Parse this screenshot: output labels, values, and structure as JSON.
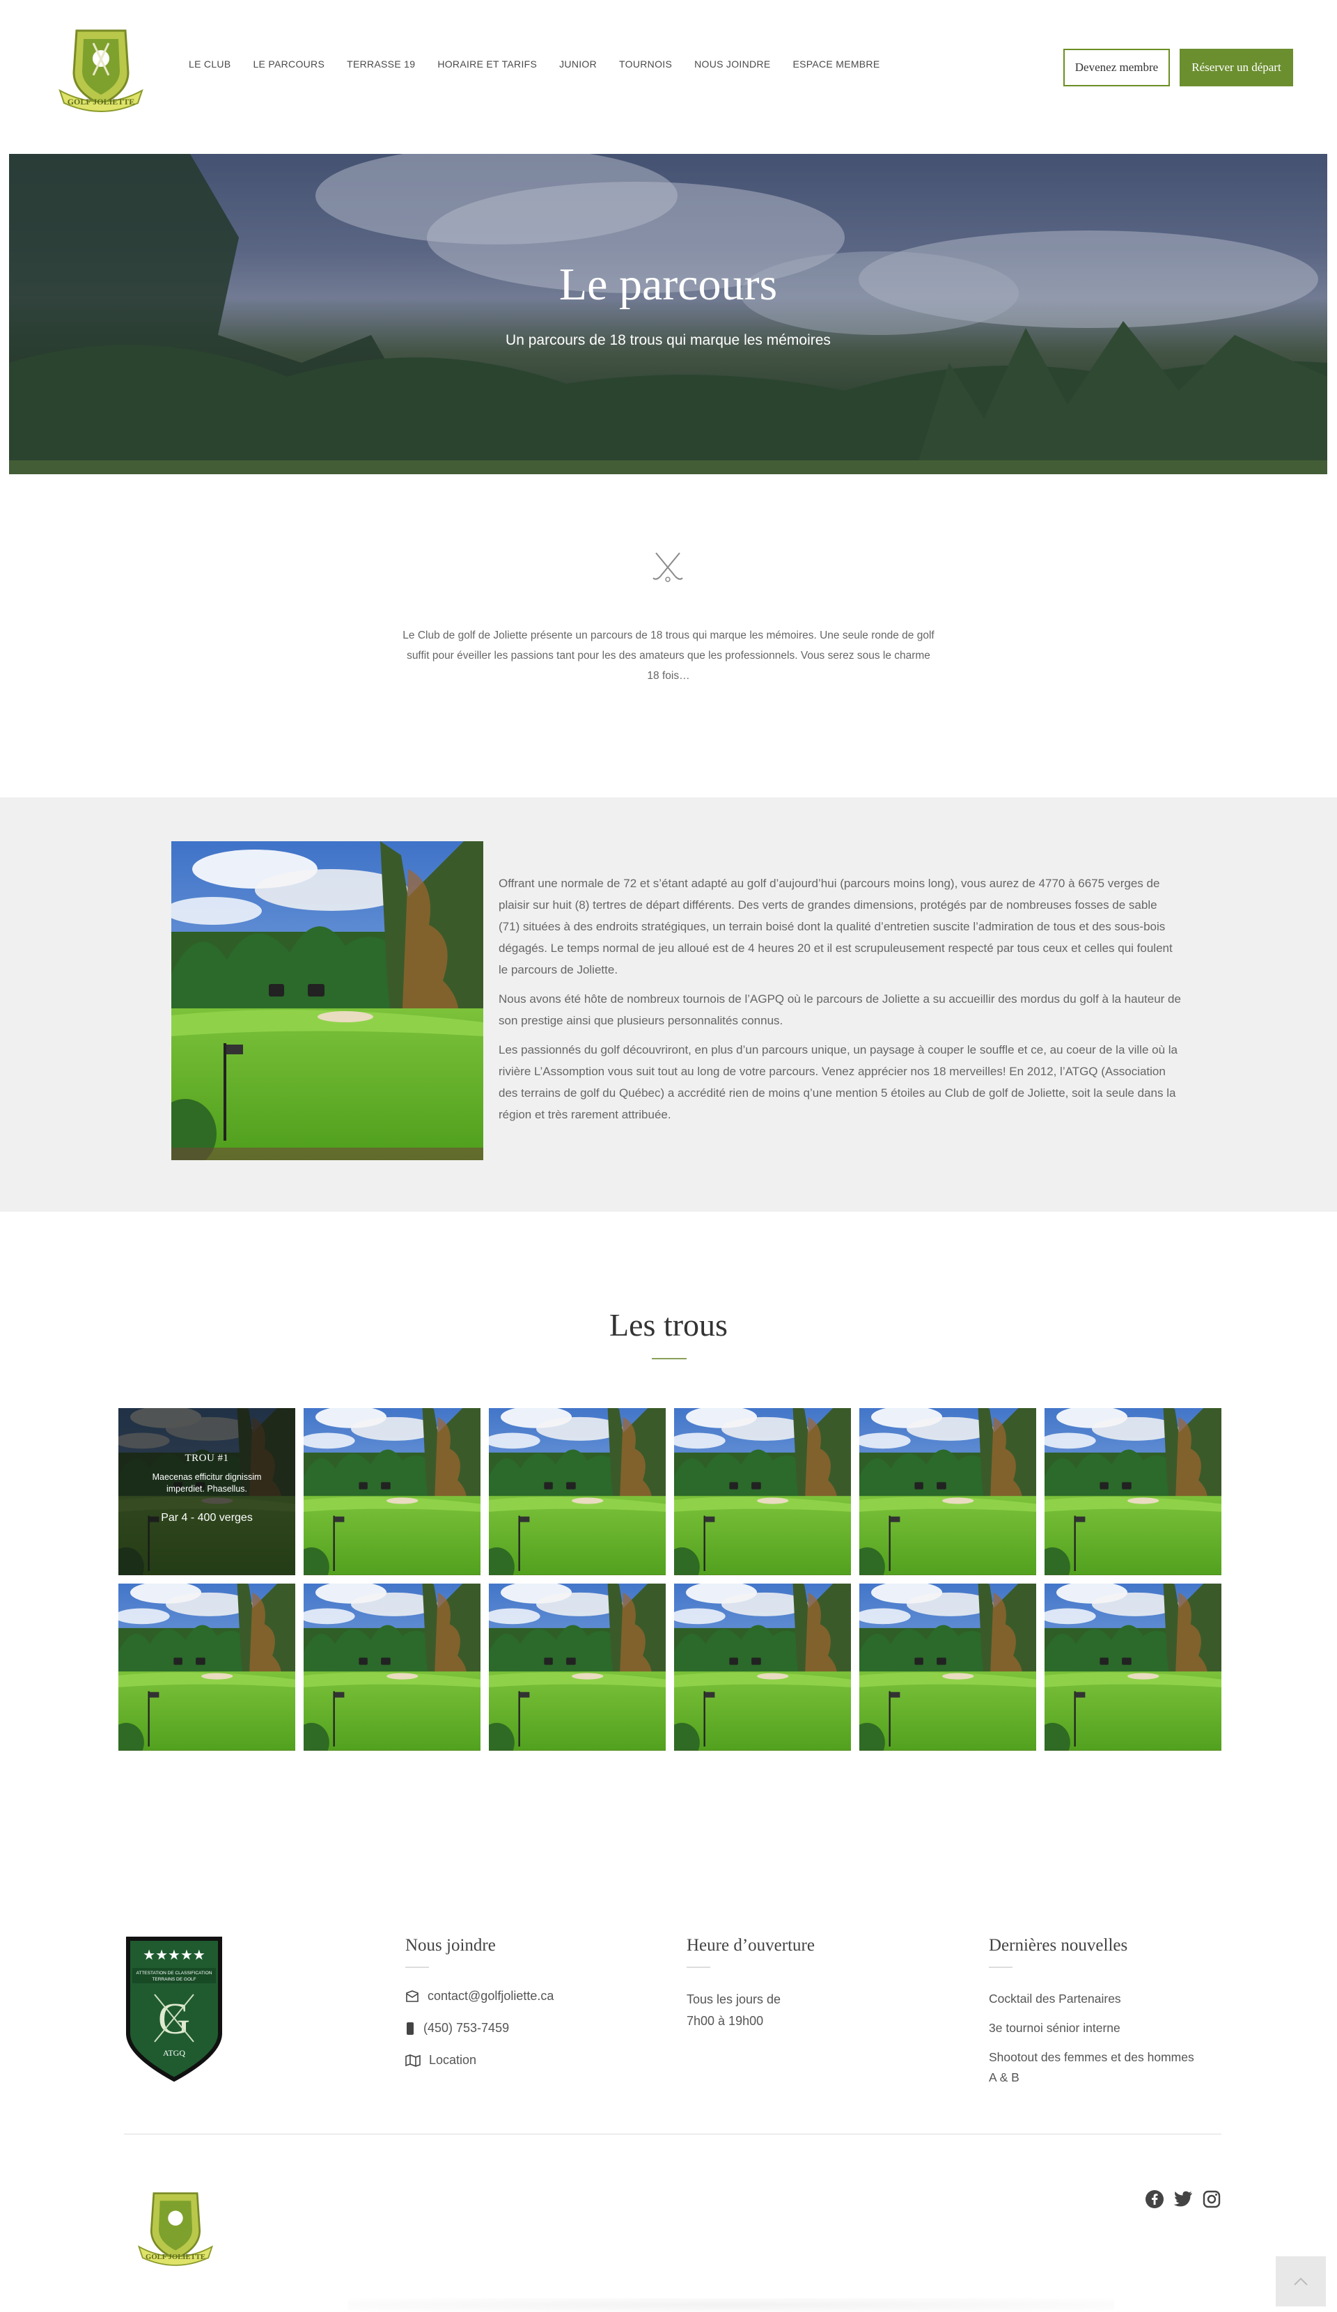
{
  "header": {
    "logo_alt": "Golf Joliette",
    "nav": [
      "LE CLUB",
      "LE PARCOURS",
      "TERRASSE 19",
      "HORAIRE ET TARIFS",
      "JUNIOR",
      "TOURNOIS",
      "NOUS JOINDRE",
      "ESPACE MEMBRE"
    ],
    "btn_member": "Devenez membre",
    "btn_book": "Réserver un départ"
  },
  "hero": {
    "title": "Le parcours",
    "subtitle": "Un parcours de 18 trous qui marque les mémoires"
  },
  "intro": {
    "icon": "crossed-golf-clubs-icon",
    "text": "Le Club de golf de Joliette présente un parcours de 18 trous qui marque les mémoires. Une seule ronde de golf suffit pour éveiller les passions tant pour les des amateurs que les professionnels. Vous serez sous le charme 18 fois…"
  },
  "description": {
    "p1": "Offrant une normale de 72 et s’étant adapté au golf d’aujourd’hui (parcours moins long), vous aurez de 4770 à 6675 verges de plaisir sur huit (8) tertres de départ différents. Des verts de grandes dimensions, protégés par de nombreuses fosses de sable (71) situées à des endroits stratégiques, un terrain boisé dont la qualité d’entretien suscite l’admiration de tous et des sous-bois dégagés. Le temps normal de jeu alloué est de 4 heures 20 et il est scrupuleusement respecté par tous ceux et celles qui foulent le parcours de Joliette.",
    "p2": "Nous avons été hôte de nombreux tournois de l’AGPQ où le parcours de Joliette a su accueillir des mordus du golf à la hauteur de son prestige ainsi que plusieurs personnalités connus.",
    "p3": "Les passionnés du golf découvriront, en plus d’un parcours unique, un paysage à couper le souffle et ce, au coeur de la ville où la rivière L’Assomption vous suit tout au long de votre parcours. Venez apprécier nos 18 merveilles! En 2012, l’ATGQ (Association des terrains de golf du Québec) a accrédité rien de moins q’une mention 5 étoiles au Club de golf de Joliette, soit la seule dans la région et très rarement attribuée."
  },
  "holes": {
    "title": "Les trous",
    "first": {
      "name": "TROU #1",
      "desc": "Maecenas efficitur dignissim imperdiet. Phasellus.",
      "par": "Par 4 - 400 verges"
    },
    "count": 12
  },
  "footer": {
    "badge": {
      "stars": "★★★★★",
      "line1": "ATTESTATION DE CLASSIFICATION",
      "line2": "TERRAINS DE GOLF",
      "letter": "G",
      "org": "ATGQ"
    },
    "contact": {
      "title": "Nous joindre",
      "email": "contact@golfjoliette.ca",
      "phone": "(450) 753-7459",
      "location": "Location"
    },
    "hours": {
      "title": "Heure d’ouverture",
      "line1": "Tous les jours de",
      "line2": "7h00 à 19h00"
    },
    "news": {
      "title": "Dernières nouvelles",
      "items": [
        "Cocktail des Partenaires",
        "3e tournoi sénior interne",
        "Shootout des femmes et des hommes A & B"
      ]
    },
    "social": [
      "facebook-icon",
      "twitter-icon",
      "instagram-icon"
    ]
  },
  "colors": {
    "accent": "#6b8e2f",
    "footer_bg": "#ffffff",
    "gray_bg": "#f0f0f0"
  }
}
